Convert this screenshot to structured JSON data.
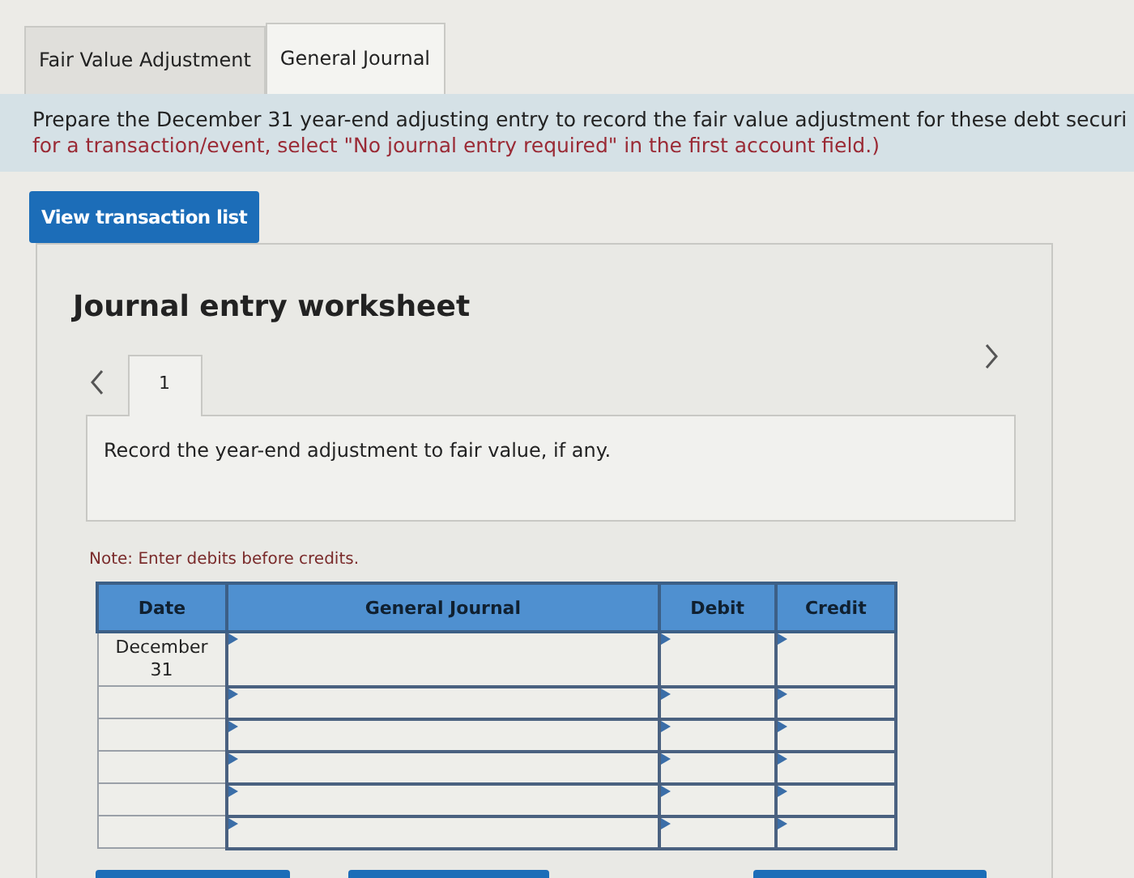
{
  "tabs": [
    {
      "label": "Fair Value Adjustment",
      "selected": false
    },
    {
      "label": "General Journal",
      "selected": true
    }
  ],
  "instructions": {
    "line_1": "Prepare the December 31 year-end adjusting entry to record the fair value adjustment for these debt securi",
    "line_2": "for a transaction/event, select \"No journal entry required\" in the first account field.)"
  },
  "view_button": "View transaction list",
  "worksheet": {
    "title": "Journal entry worksheet",
    "entry_tabs": [
      {
        "label": "1",
        "selected": true
      }
    ],
    "prompt": "Record the year-end adjustment to fair value, if any.",
    "note": "Note: Enter debits before credits.",
    "table": {
      "columns": [
        "Date",
        "General Journal",
        "Debit",
        "Credit"
      ],
      "rows": [
        {
          "date": "December 31"
        },
        {},
        {},
        {},
        {},
        {}
      ]
    }
  }
}
